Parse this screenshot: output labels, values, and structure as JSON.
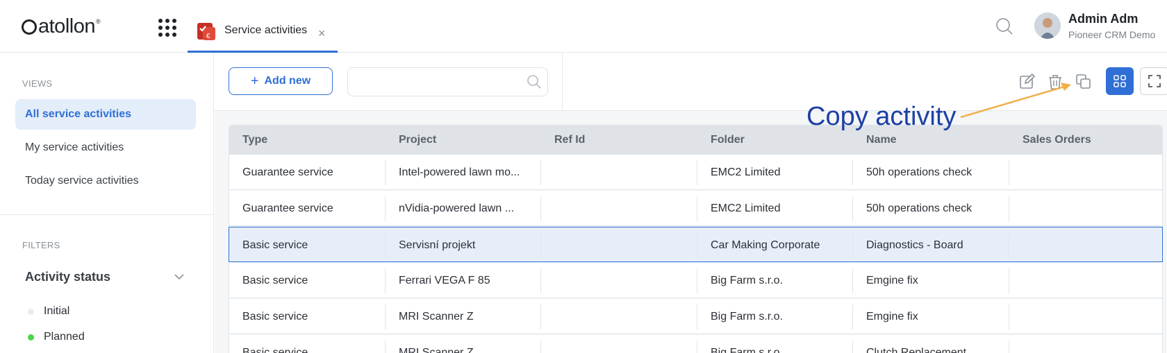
{
  "app": {
    "logo_text": "atollon",
    "logo_reg": "®"
  },
  "tab": {
    "label": "Service activities",
    "close": "×"
  },
  "user": {
    "name": "Admin Adm",
    "org": "Pioneer CRM Demo"
  },
  "sidebar": {
    "views_title": "VIEWS",
    "views": [
      {
        "label": "All service activities",
        "active": true
      },
      {
        "label": "My service activities",
        "active": false
      },
      {
        "label": "Today service activities",
        "active": false
      }
    ],
    "filters_title": "FILTERS",
    "filter": {
      "title": "Activity status",
      "options": [
        {
          "label": "Initial",
          "color": "#e9ecef"
        },
        {
          "label": "Planned",
          "color": "#4cd44c"
        }
      ]
    }
  },
  "toolbar": {
    "add_label": "Add new",
    "add_plus": "+",
    "search_placeholder": "",
    "icons": [
      "edit-icon",
      "trash-icon",
      "copy-icon",
      "grid-view-icon",
      "fullscreen-icon"
    ]
  },
  "table": {
    "columns": [
      "Type",
      "Project",
      "Ref Id",
      "Folder",
      "Name",
      "Sales Orders"
    ],
    "rows": [
      {
        "type": "Guarantee service",
        "project": "Intel-powered lawn mo...",
        "ref_id": "",
        "folder": "EMC2 Limited",
        "name": "50h operations check",
        "sales_orders": "",
        "selected": false
      },
      {
        "type": "Guarantee service",
        "project": "nVidia-powered lawn ...",
        "ref_id": "",
        "folder": "EMC2 Limited",
        "name": "50h operations check",
        "sales_orders": "",
        "selected": false
      },
      {
        "type": "Basic service",
        "project": "Servisní projekt",
        "ref_id": "",
        "folder": "Car Making Corporate",
        "name": "Diagnostics - Board",
        "sales_orders": "",
        "selected": true
      },
      {
        "type": "Basic service",
        "project": "Ferrari VEGA F 85",
        "ref_id": "",
        "folder": "Big Farm s.r.o.",
        "name": "Emgine fix",
        "sales_orders": "",
        "selected": false
      },
      {
        "type": "Basic service",
        "project": "MRI Scanner Z",
        "ref_id": "",
        "folder": "Big Farm s.r.o.",
        "name": "Emgine fix",
        "sales_orders": "",
        "selected": false
      },
      {
        "type": "Basic service",
        "project": "MRI Scanner Z",
        "ref_id": "",
        "folder": "Big Farm s.r.o.",
        "name": "Clutch Replacement",
        "sales_orders": "",
        "selected": false
      }
    ]
  },
  "annotation": {
    "text": "Copy activity",
    "color": "#1d3fa6",
    "arrow_color": "#f0b04a"
  },
  "colors": {
    "accent": "#2f6fd6",
    "brand_red": "#d8392b"
  }
}
